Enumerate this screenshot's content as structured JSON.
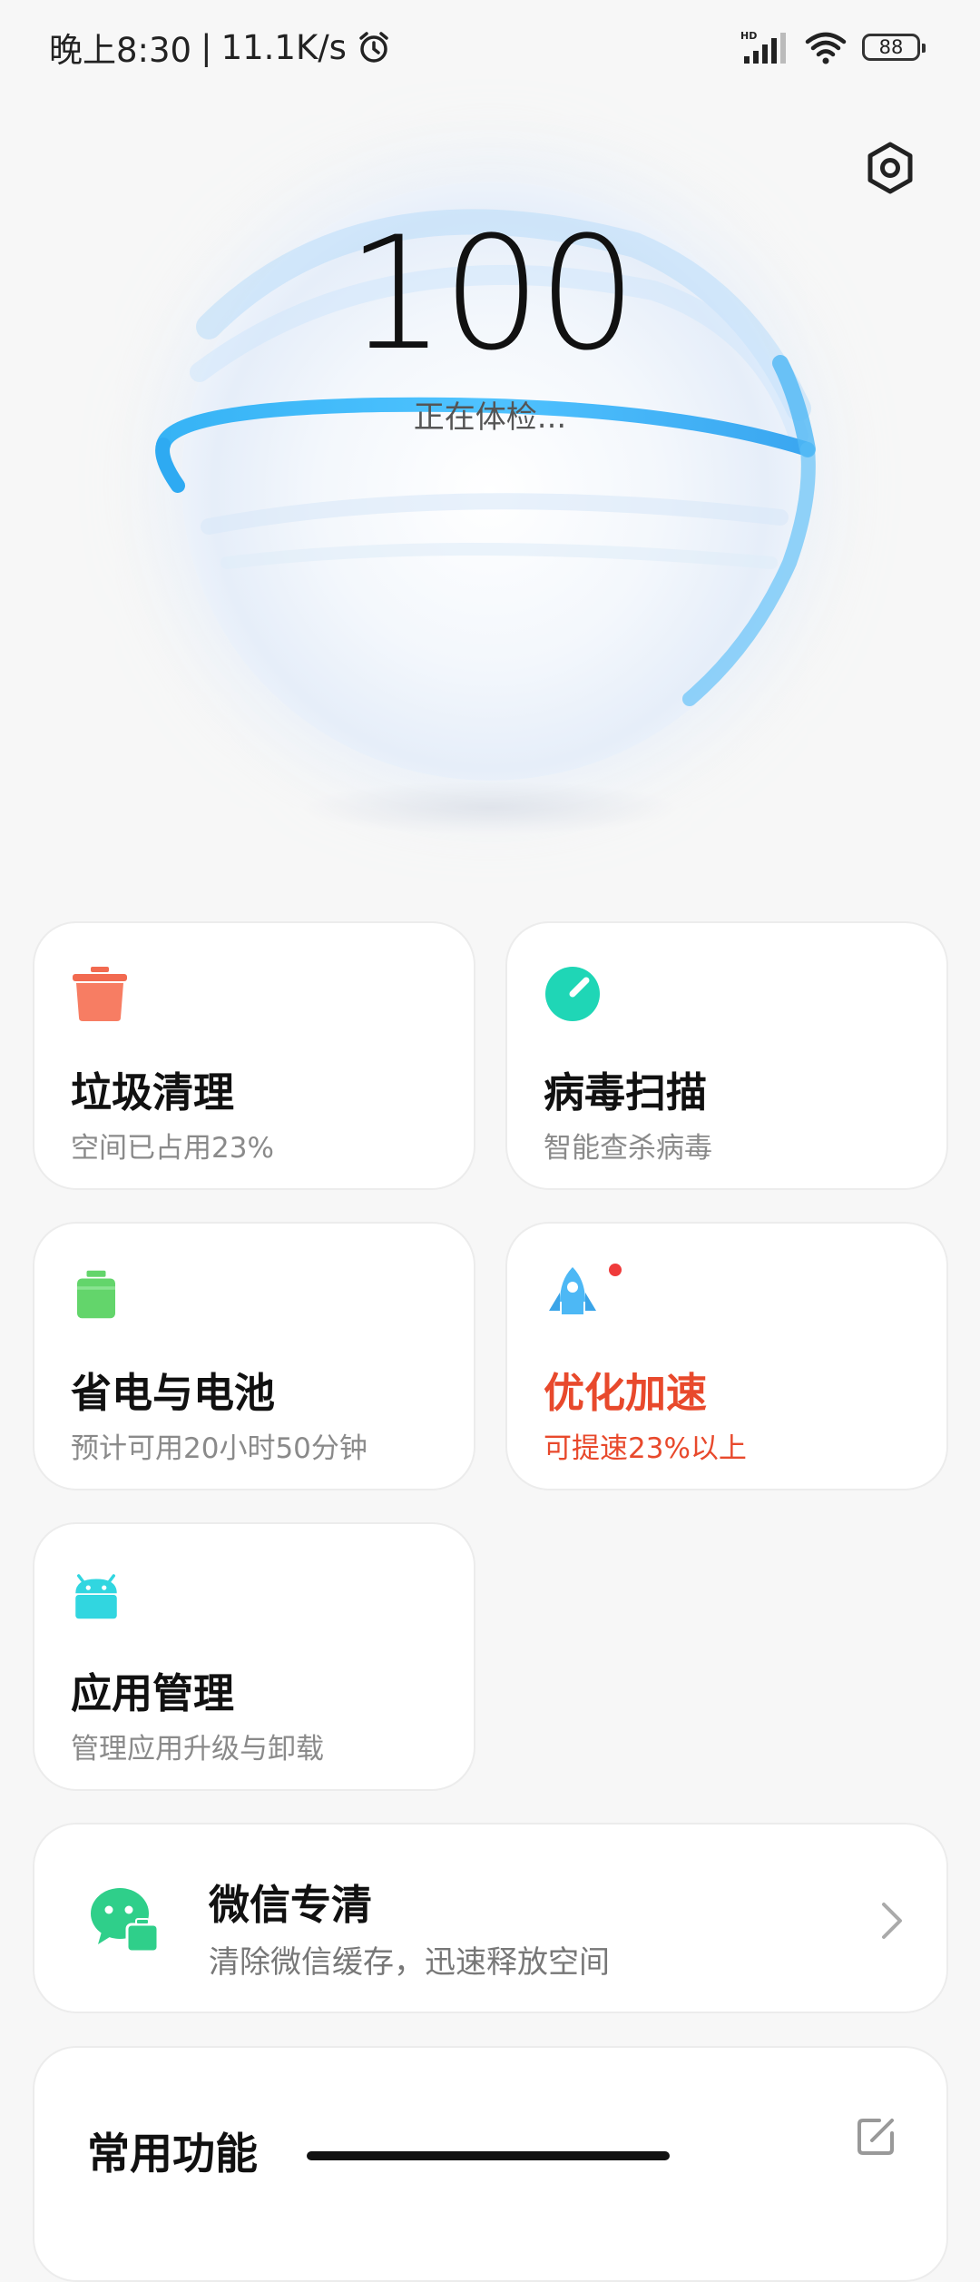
{
  "status_bar": {
    "time": "晚上8:30",
    "separator": "|",
    "speed": "11.1K/s",
    "network_label": "HD",
    "battery": "88"
  },
  "hero": {
    "score": "100",
    "status": "正在体检..."
  },
  "cards": [
    {
      "title": "垃圾清理",
      "subtitle": "空间已占用23%",
      "icon": "trash-icon",
      "color": "#f26a50"
    },
    {
      "title": "病毒扫描",
      "subtitle": "智能查杀病毒",
      "icon": "shield-scan-icon",
      "color": "#1fd6b6"
    },
    {
      "title": "省电与电池",
      "subtitle": "预计可用20小时50分钟",
      "icon": "battery-icon",
      "color": "#63d56b"
    },
    {
      "title": "优化加速",
      "subtitle": "可提速23%以上",
      "icon": "rocket-icon",
      "color": "#4db8f5"
    },
    {
      "title": "应用管理",
      "subtitle": "管理应用升级与卸载",
      "icon": "android-icon",
      "color": "#31d6e0"
    }
  ],
  "wechat": {
    "title": "微信专清",
    "subtitle": "清除微信缓存，迅速释放空间"
  },
  "common": {
    "title": "常用功能"
  }
}
